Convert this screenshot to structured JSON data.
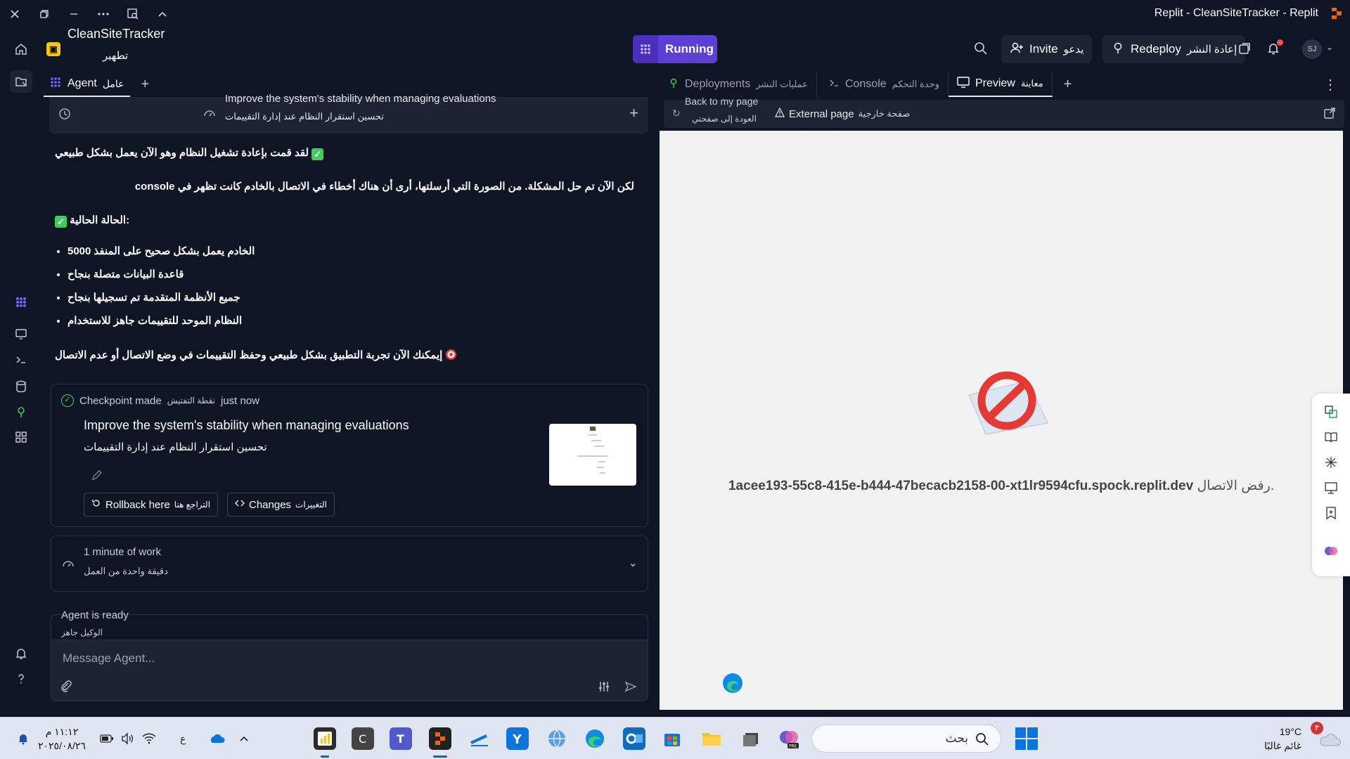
{
  "window": {
    "title": "Replit - CleanSiteTracker - Replit"
  },
  "project": {
    "name": "CleanSiteTracker",
    "subtitle": "تطهير"
  },
  "header": {
    "run_label": "Running",
    "invite_label": "Invite",
    "invite_ar": "يدعو",
    "redeploy_label": "Redeploy",
    "redeploy_ar": "إعادة النشر",
    "avatar_initials": "SJ"
  },
  "agent_tab": {
    "label": "Agent",
    "label_ar": "عامل"
  },
  "step_card": {
    "title": "Improve the system's stability when managing evaluations",
    "title_ar": "تحسين استقرار النظام عند إدارة التقييمات"
  },
  "messages": {
    "restart": "لقد قمت بإعادة تشغيل النظام وهو الآن يعمل بشكل طبيعي",
    "solved": "لكن الآن تم حل المشكلة. من الصورة التي أرسلتها، أرى أن هناك أخطاء في الاتصال بالخادم كانت تظهر في console",
    "status_heading": "الحالة الحالية:",
    "bullets": [
      "الخادم يعمل بشكل صحيح على المنفذ 5000",
      "قاعدة البيانات متصلة بنجاح",
      "جميع الأنظمة المتقدمة تم تسجيلها بنجاح",
      "النظام الموحد للتقييمات جاهز للاستخدام"
    ],
    "closing": "إيمكنك الآن تجربة التطبيق بشكل طبيعي وحفظ التقييمات في وضع الاتصال أو عدم الاتصال"
  },
  "checkpoint": {
    "label": "Checkpoint made",
    "label_ar": "نقطة التفتيش",
    "time": "just now",
    "title": "Improve the system's stability when managing evaluations",
    "title_ar": "تحسين استقرار النظام عند إدارة التقييمات",
    "rollback_label": "Rollback here",
    "rollback_ar": "التراجع هنا",
    "changes_label": "Changes",
    "changes_ar": "التغييرات"
  },
  "work": {
    "label": "1 minute of work",
    "label_ar": "دقيقة واحدة من العمل"
  },
  "composer": {
    "status": "Agent is ready",
    "status_ar": "الوكيل جاهز",
    "placeholder": "Message Agent..."
  },
  "right_tabs": [
    {
      "label": "Deployments",
      "label_ar": "عمليات النشر"
    },
    {
      "label": "Console",
      "label_ar": "وحدة التحكم"
    },
    {
      "label": "Preview",
      "label_ar": "معاينة"
    }
  ],
  "address_bar": {
    "back_label": "Back to my page",
    "back_ar": "العودة إلى صفحتي",
    "external_label": "External page",
    "external_ar": "صفحة خارجية"
  },
  "preview": {
    "host": "1acee193-55c8-415e-b444-47becacb2158-00-xt1lr9594cfu.spock.replit.dev",
    "refused_ar": "رفض الاتصال."
  },
  "taskbar": {
    "time": "١١:١٢ م",
    "date": "٢٠٢٥/٠٨/٢٦",
    "lang": "ع",
    "search_placeholder": "بحث",
    "weather_temp": "19°C",
    "weather_desc": "غائم غالبًا",
    "weather_badge": "٣"
  },
  "colors": {
    "bg": "#0e1525",
    "surface": "#1c2333",
    "accent": "#5b3fd6",
    "success": "#3ecf5a",
    "preview_bg": "#f2f2f2"
  }
}
